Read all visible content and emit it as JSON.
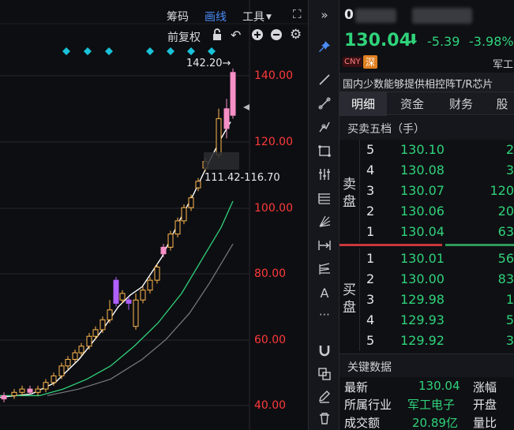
{
  "toolbar": {
    "chips_label": "筹码",
    "draw_label": "画线",
    "tools_label": "工具",
    "adjust_label": "前复权"
  },
  "chart": {
    "high_marker": "142.20→",
    "range_marker": "111.42-116.70",
    "price_ticks": [
      "140.00",
      "120.00",
      "100.00",
      "80.00",
      "60.00",
      "40.00"
    ],
    "colors": {
      "up": "#ffb84d",
      "up_fill": "#f68fc5",
      "down": "#b060ff",
      "ma1": "#ffffff",
      "ma2": "#2fd27a",
      "ma3": "#7a7a80",
      "tick": "#ff3a3a",
      "diamond": "#19c2d8"
    }
  },
  "stock": {
    "code": "0",
    "price": "130.04",
    "change": "-5.39",
    "change_pct": "-3.98%",
    "tag_cny": "CNY",
    "tag_sz": "深",
    "sector_short": "军工",
    "description": "国内少数能够提供相控阵T/R芯片"
  },
  "tabs": [
    "明细",
    "资金",
    "财务",
    "股"
  ],
  "orderbook": {
    "title": "买卖五档（手）",
    "sell_label": [
      "卖",
      "盘"
    ],
    "buy_label": [
      "买",
      "盘"
    ],
    "sell": [
      {
        "level": "5",
        "price": "130.10",
        "vol": "2"
      },
      {
        "level": "4",
        "price": "130.08",
        "vol": "3"
      },
      {
        "level": "3",
        "price": "130.07",
        "vol": "120"
      },
      {
        "level": "2",
        "price": "130.06",
        "vol": "20"
      },
      {
        "level": "1",
        "price": "130.04",
        "vol": "63"
      }
    ],
    "buy": [
      {
        "level": "1",
        "price": "130.01",
        "vol": "56"
      },
      {
        "level": "2",
        "price": "130.00",
        "vol": "83"
      },
      {
        "level": "3",
        "price": "129.98",
        "vol": "1"
      },
      {
        "level": "4",
        "price": "129.93",
        "vol": "5"
      },
      {
        "level": "5",
        "price": "129.92",
        "vol": "3"
      }
    ]
  },
  "key_data": {
    "title": "关键数据",
    "latest_label": "最新",
    "latest_value": "130.04",
    "change_label": "涨幅",
    "industry_label": "所属行业",
    "industry_value": "军工电子",
    "open_label": "开盘",
    "volume_label": "成交额",
    "volume_value": "20.89亿",
    "ratio_label": "量比"
  }
}
